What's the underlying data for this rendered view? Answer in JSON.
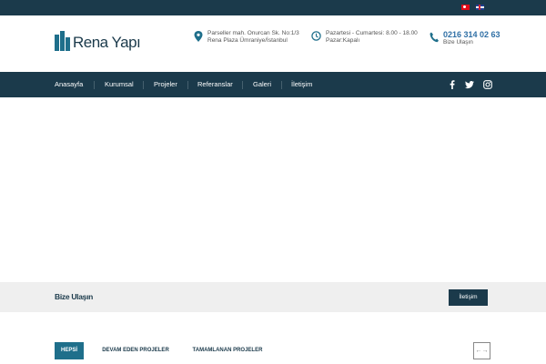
{
  "topbar": {
    "languages": [
      {
        "name": "turkish-flag-icon",
        "code": "tr",
        "color": "#e30a17"
      },
      {
        "name": "uk-flag-icon",
        "code": "en",
        "color": "#1f3f8f"
      }
    ]
  },
  "header": {
    "logo_text": "Rena Yapı",
    "address_line1": "Parseller mah. Onurcan Sk. No:1/3",
    "address_line2": "Rena Plaza Ümraniye/İstanbul",
    "hours_line1": "Pazartesi - Cumartesi: 8.00 - 18.00",
    "hours_line2": "Pazar:Kapalı",
    "phone": "0216 314 02 63",
    "phone_sub": "Bize Ulaşın",
    "icons": {
      "address": "map-pin-icon",
      "hours": "clock-icon",
      "phone": "phone-icon"
    }
  },
  "nav": {
    "items": [
      "Anasayfa",
      "Kurumsal",
      "Projeler",
      "Referanslar",
      "Galeri",
      "İletişim"
    ],
    "social": [
      "facebook-icon",
      "twitter-icon",
      "instagram-icon"
    ]
  },
  "cta": {
    "title": "Bize Ulaşın",
    "button": "İletişim"
  },
  "tabs": {
    "items": [
      "HEPSİ",
      "DEVAM EDEN PROJELER",
      "TAMAMLANAN PROJELER"
    ],
    "active_index": 0,
    "arrows": "←→"
  },
  "colors": {
    "primary": "#1b3a4b",
    "accent": "#1f6f8b",
    "phone": "#2f6fa5"
  }
}
